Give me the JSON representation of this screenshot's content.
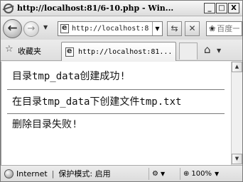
{
  "window": {
    "title": "http://localhost:81/6-10.php - Win...",
    "buttons": {
      "minimize": "_",
      "maximize": "□",
      "close": "X"
    }
  },
  "nav": {
    "back": "←",
    "forward": "→",
    "dropdown": "▼",
    "address": "http://localhost:8",
    "address_dropdown": "▼",
    "refresh": "⇆",
    "stop": "✕",
    "search_placeholder": "百度一"
  },
  "favorites": {
    "label": "收藏夹",
    "tab_title": "http://localhost:81...",
    "home_dropdown": "▼"
  },
  "content": {
    "lines": [
      "目录tmp_data创建成功!",
      "在目录tmp_data下创建文件tmp.txt",
      "删除目录失败!"
    ]
  },
  "scrollbar": {
    "up": "▲",
    "down": "▼"
  },
  "status": {
    "zone": "Internet",
    "separator": "|",
    "protected_mode": "保护模式: 启用",
    "zoom": "100%",
    "zoom_dropdown": "▼"
  }
}
